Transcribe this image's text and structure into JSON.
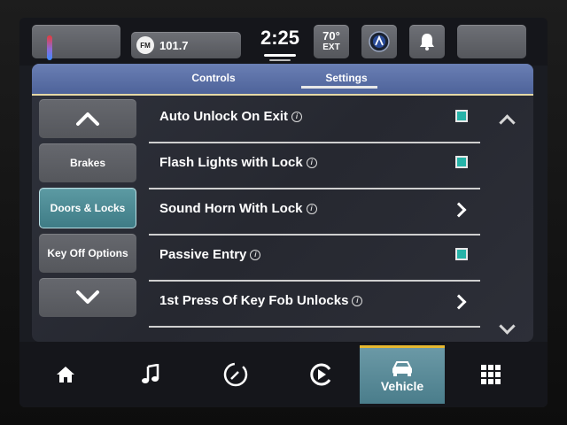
{
  "status": {
    "radio_band": "FM",
    "radio_freq": "101.7",
    "time": "2:25",
    "temp_value": "70°",
    "temp_label": "EXT"
  },
  "tabs": {
    "controls": "Controls",
    "settings": "Settings"
  },
  "sidebar": {
    "items": [
      {
        "label": "Brakes"
      },
      {
        "label": "Doors & Locks"
      },
      {
        "label": "Key Off Options"
      }
    ]
  },
  "settings": {
    "rows": [
      {
        "label": "Auto Unlock On Exit",
        "control": "checkbox",
        "checked": true
      },
      {
        "label": "Flash Lights with Lock",
        "control": "checkbox",
        "checked": true
      },
      {
        "label": "Sound Horn With Lock",
        "control": "arrow"
      },
      {
        "label": "Passive Entry",
        "control": "checkbox",
        "checked": true
      },
      {
        "label": "1st Press Of Key Fob Unlocks",
        "control": "arrow"
      }
    ]
  },
  "nav": {
    "vehicle_label": "Vehicle"
  },
  "colors": {
    "accent_teal": "#27b3a8",
    "tab_blue": "#5a6fa6",
    "active_nav": "#5d8d9a",
    "active_indicator": "#e6b830"
  }
}
